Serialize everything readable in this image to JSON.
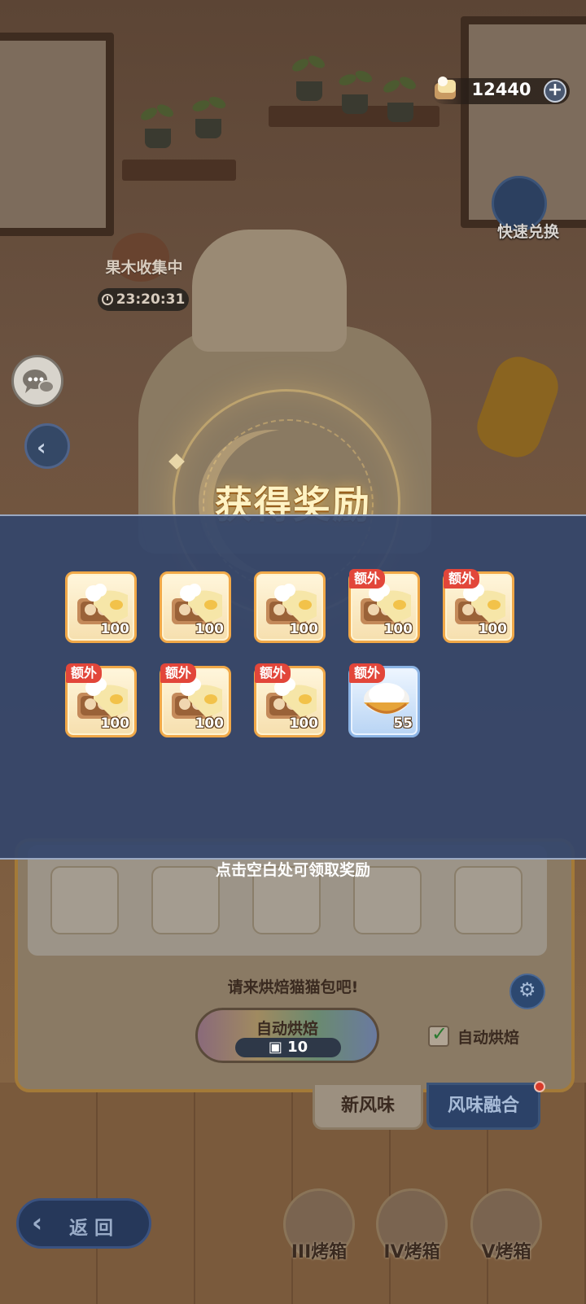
{
  "top": {
    "currency_value": "12440",
    "plus_label": "+",
    "quick_exchange_label": "快速兑换"
  },
  "collect": {
    "label": "果木收集中",
    "timer": "23:20:31"
  },
  "reward": {
    "title": "获得奖励",
    "extra_badge": "额外",
    "claim_hint": "点击空白处可领取奖励",
    "rows": [
      [
        {
          "type": "bread",
          "qty": "100",
          "extra": false
        },
        {
          "type": "bread",
          "qty": "100",
          "extra": false
        },
        {
          "type": "bread",
          "qty": "100",
          "extra": false
        },
        {
          "type": "bread",
          "qty": "100",
          "extra": true
        },
        {
          "type": "bread",
          "qty": "100",
          "extra": true
        }
      ],
      [
        {
          "type": "bread",
          "qty": "100",
          "extra": true
        },
        {
          "type": "bread",
          "qty": "100",
          "extra": true
        },
        {
          "type": "bread",
          "qty": "100",
          "extra": true
        },
        {
          "type": "flour-bowl",
          "qty": "55",
          "extra": true
        }
      ]
    ]
  },
  "baking": {
    "prompt": "请来烘焙猫猫包吧!",
    "auto_bake_label": "自动烘焙",
    "auto_bake_cost": "10",
    "auto_check_label": "自动烘焙",
    "tab_new": "新风味",
    "tab_fusion": "风味融合"
  },
  "nav": {
    "return_label": "返回",
    "boxes": [
      "III烤箱",
      "IV烤箱",
      "V烤箱"
    ]
  },
  "colors": {
    "panel": "#34466c",
    "item_border": "#f0a848",
    "extra_badge": "#e2463a",
    "title_gold": "#fff3c4"
  }
}
